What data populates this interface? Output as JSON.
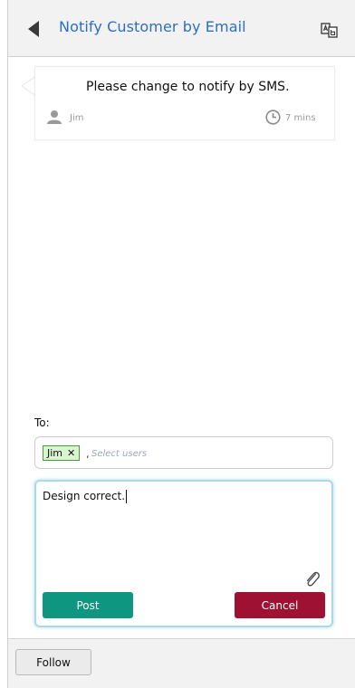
{
  "header": {
    "title": "Notify Customer by Email",
    "back_icon": "back-arrow-icon",
    "action_icon": "translate-icon",
    "title_color": "#2b6fc4"
  },
  "comment": {
    "text": "Please change to notify by SMS.",
    "author": "Jim",
    "time": "7 mins",
    "author_icon": "person-icon",
    "time_icon": "clock-icon"
  },
  "compose": {
    "to_label": "To:",
    "recipients": [
      {
        "name": "Jim",
        "remove": "✕"
      }
    ],
    "separator": ",",
    "placeholder": "Select users",
    "body": "Design correct.",
    "attach_icon": "paperclip-icon",
    "post_label": "Post",
    "cancel_label": "Cancel",
    "post_color": "#0e9680",
    "cancel_color": "#9e1132"
  },
  "footer": {
    "follow_label": "Follow"
  }
}
